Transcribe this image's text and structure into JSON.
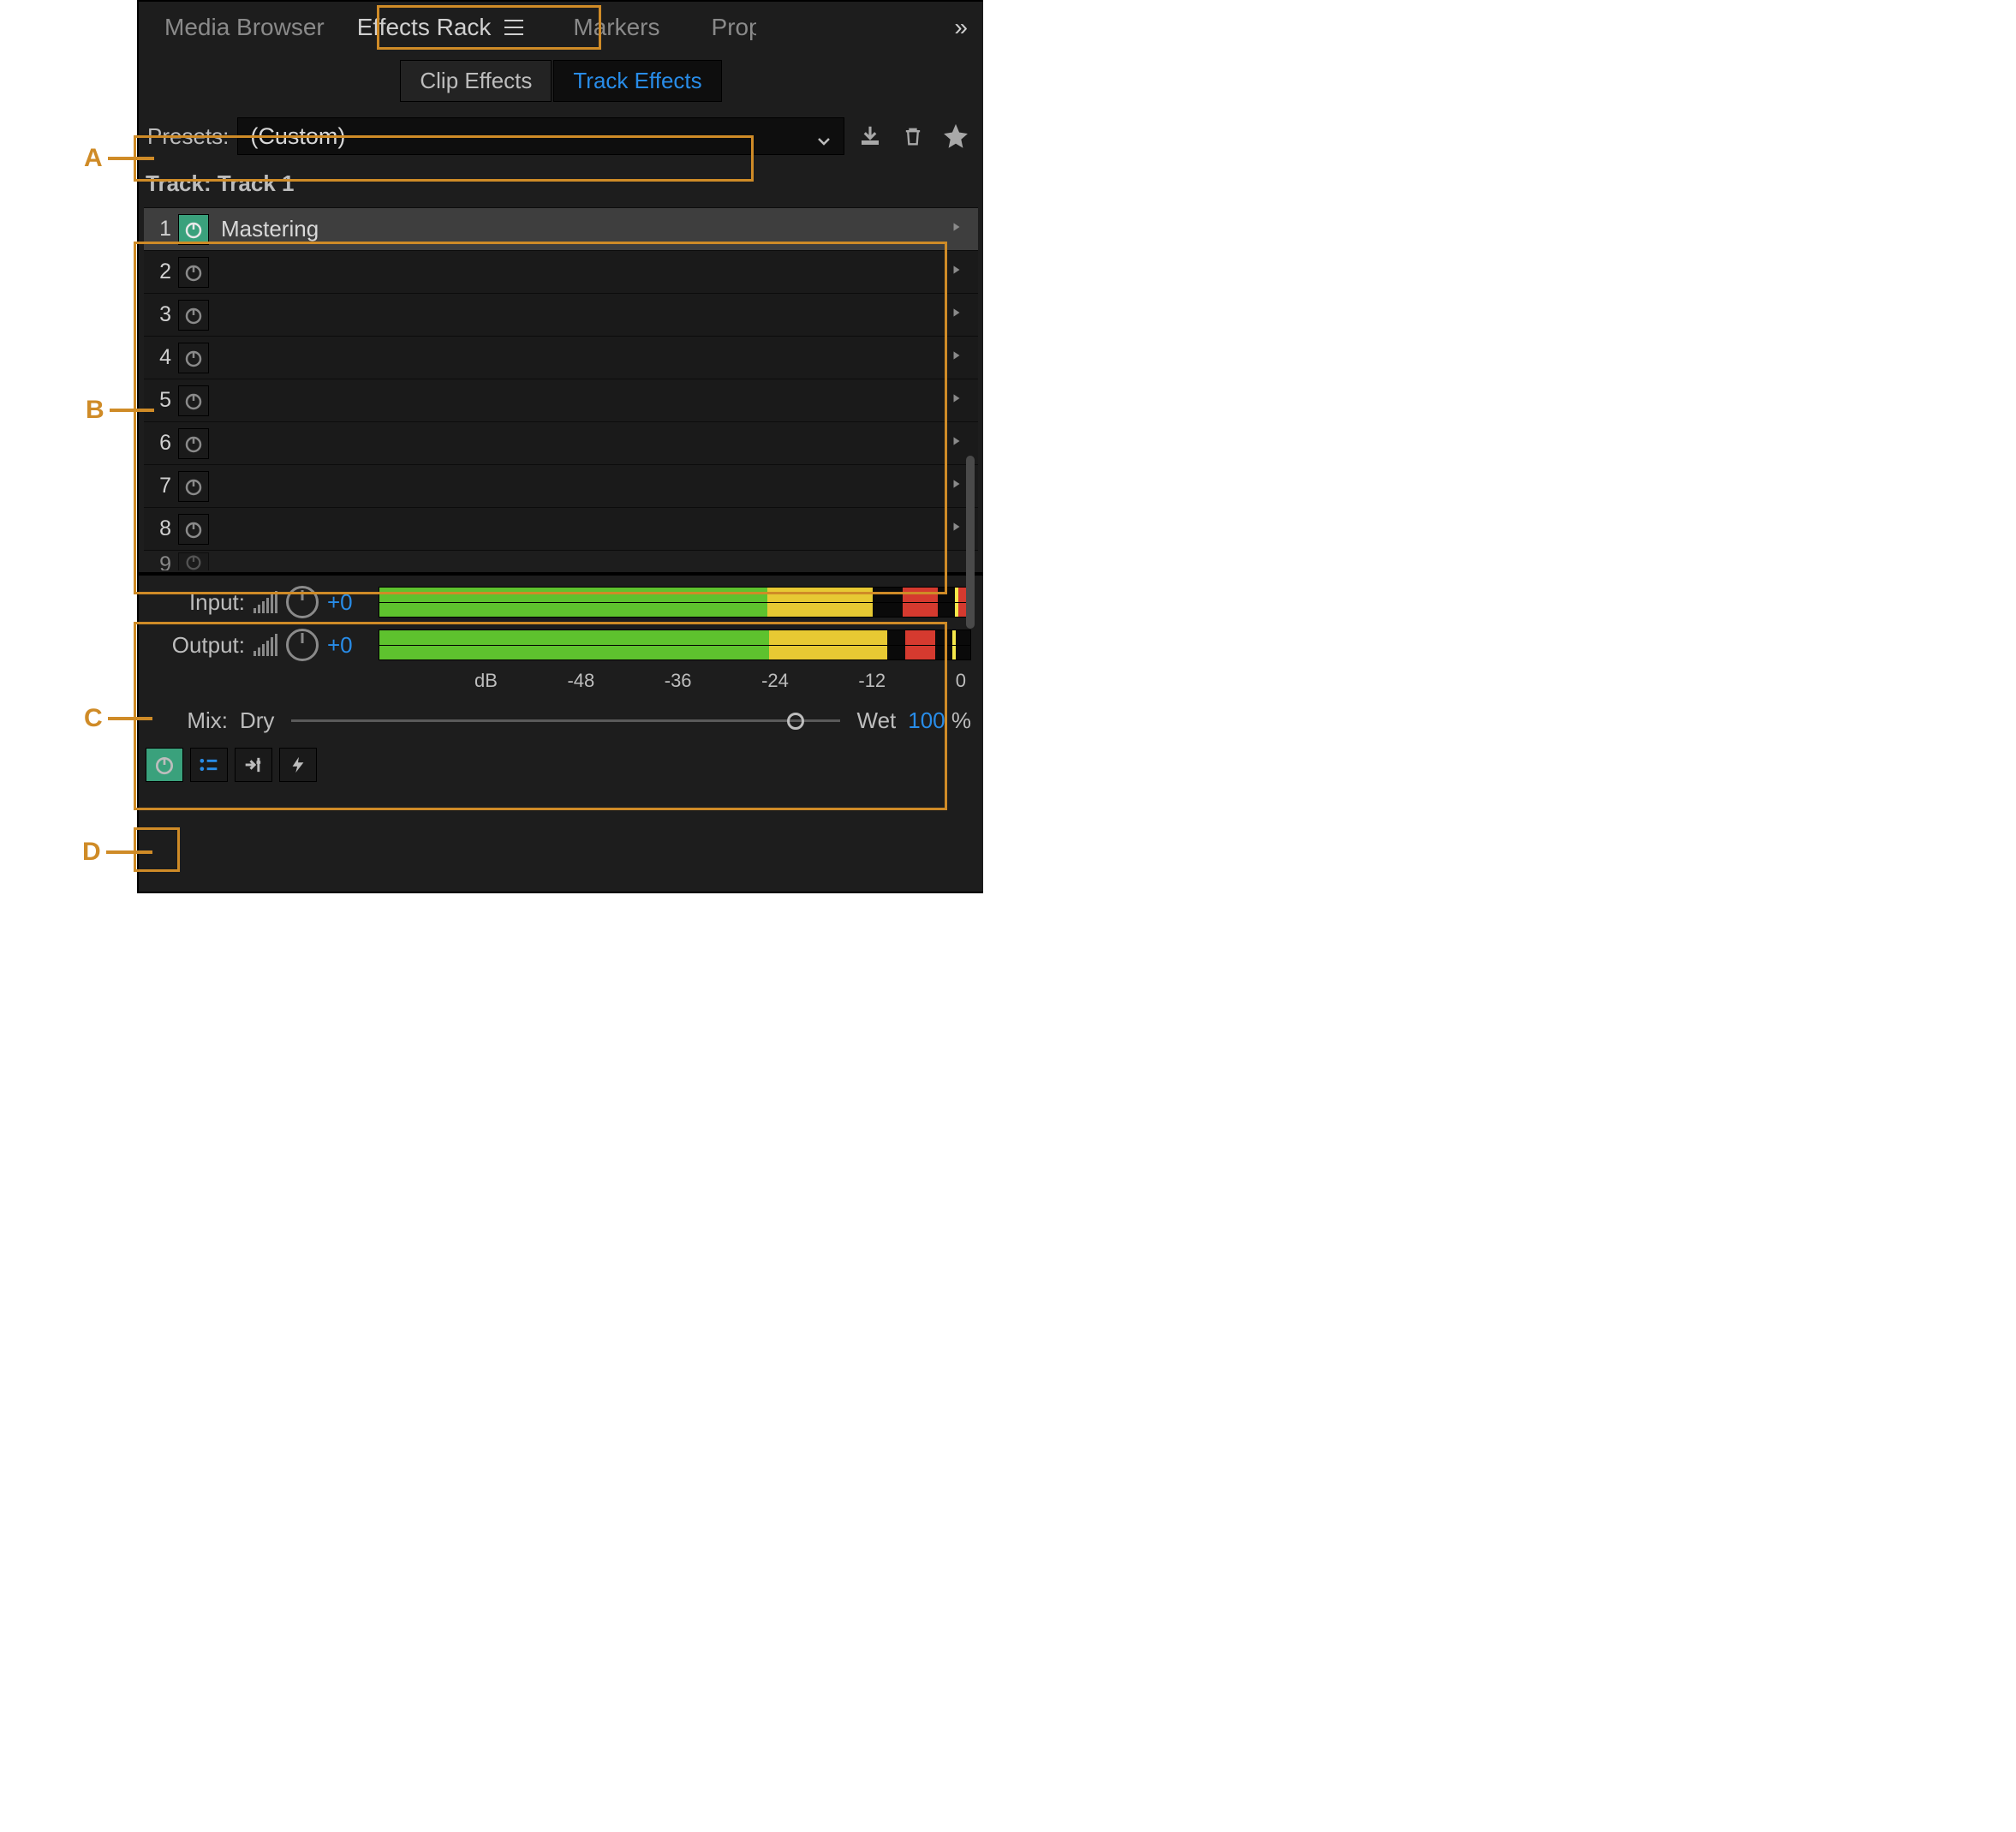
{
  "tabs": {
    "media_browser": "Media Browser",
    "effects_rack": "Effects Rack",
    "markers": "Markers",
    "properties_truncated": "Prop",
    "overflow_glyph": "»"
  },
  "subtabs": {
    "clip": "Clip Effects",
    "track": "Track Effects"
  },
  "presets": {
    "label": "Presets:",
    "value": "(Custom)"
  },
  "track": {
    "label": "Track: Track 1"
  },
  "slots": [
    {
      "num": "1",
      "name": "Mastering",
      "on": true,
      "selected": true
    },
    {
      "num": "2",
      "name": "",
      "on": false,
      "selected": false
    },
    {
      "num": "3",
      "name": "",
      "on": false,
      "selected": false
    },
    {
      "num": "4",
      "name": "",
      "on": false,
      "selected": false
    },
    {
      "num": "5",
      "name": "",
      "on": false,
      "selected": false
    },
    {
      "num": "6",
      "name": "",
      "on": false,
      "selected": false
    },
    {
      "num": "7",
      "name": "",
      "on": false,
      "selected": false
    },
    {
      "num": "8",
      "name": "",
      "on": false,
      "selected": false
    }
  ],
  "slot_partial_num": "9",
  "io": {
    "input_label": "Input:",
    "input_value": "+0",
    "output_label": "Output:",
    "output_value": "+0",
    "input_meter": {
      "ch1": {
        "green": 66,
        "yellow": 18,
        "black": 5,
        "red": 6,
        "gap": 3,
        "peak": true,
        "red2": 2
      },
      "ch2": {
        "green": 66,
        "yellow": 18,
        "black": 5,
        "red": 6,
        "gap": 3,
        "peak": true,
        "red2": 2
      }
    },
    "output_meter": {
      "ch1": {
        "green": 66,
        "yellow": 20,
        "black": 3,
        "red": 5,
        "gap": 3,
        "peak": true,
        "red2": 0
      },
      "ch2": {
        "green": 66,
        "yellow": 20,
        "black": 3,
        "red": 5,
        "gap": 3,
        "peak": true,
        "red2": 0
      }
    }
  },
  "db_ticks": [
    "dB",
    "-48",
    "-36",
    "-24",
    "-12",
    "0"
  ],
  "mix": {
    "label": "Mix:",
    "dry": "Dry",
    "wet": "Wet",
    "value": "100",
    "unit": " %",
    "position_pct": 92
  },
  "callouts": {
    "a": "A",
    "b": "B",
    "c": "C",
    "d": "D"
  }
}
